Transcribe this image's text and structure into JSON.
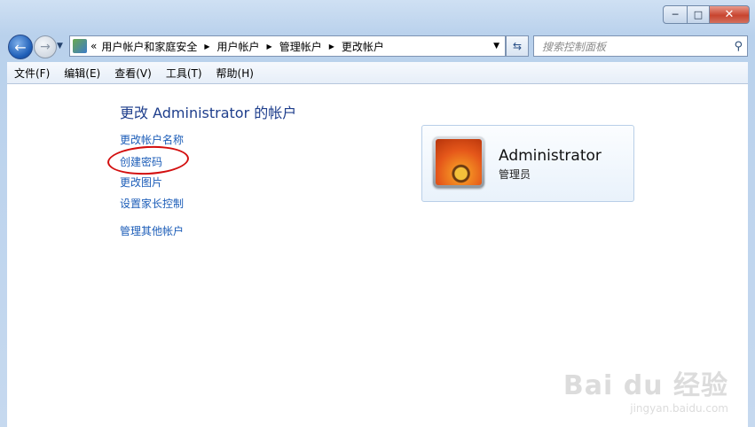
{
  "window": {
    "controls": {
      "minimize": "─",
      "maximize": "□",
      "close": "✕"
    }
  },
  "address_bar": {
    "overflow": "«",
    "crumbs": [
      "用户帐户和家庭安全",
      "管理帐户",
      "更改帐户"
    ],
    "crumb_user_accounts": "用户帐户"
  },
  "search": {
    "placeholder": "搜索控制面板"
  },
  "menu": {
    "file": "文件(F)",
    "edit": "编辑(E)",
    "view": "查看(V)",
    "tools": "工具(T)",
    "help": "帮助(H)"
  },
  "main": {
    "title": "更改 Administrator 的帐户",
    "tasks": {
      "rename": "更改帐户名称",
      "create_password": "创建密码",
      "change_picture": "更改图片",
      "parental_controls": "设置家长控制",
      "manage_other": "管理其他帐户"
    }
  },
  "account_card": {
    "name": "Administrator",
    "role": "管理员"
  },
  "watermark": {
    "brand": "Bai du 经验",
    "url": "jingyan.baidu.com"
  },
  "colors": {
    "link": "#1c5db8",
    "title": "#1e3e8c",
    "annotation_circle": "#d30f0f"
  }
}
